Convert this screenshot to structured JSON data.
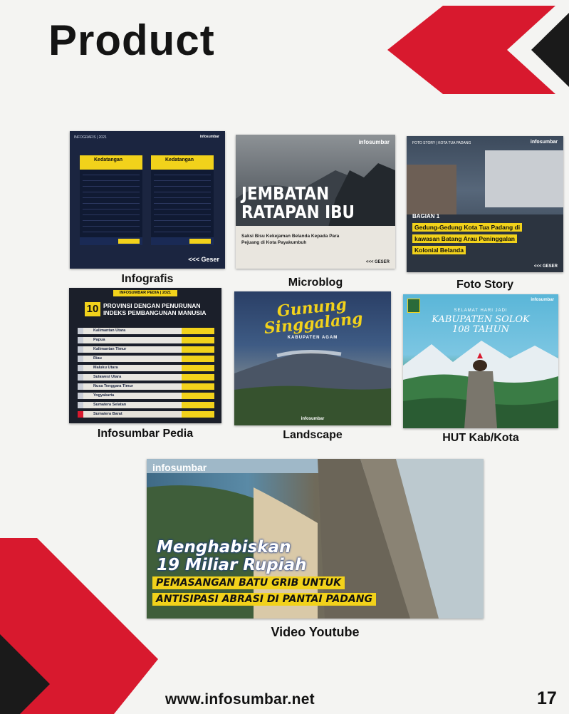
{
  "page": {
    "title": "Product",
    "website": "www.infosumbar.net",
    "page_number": "17"
  },
  "colors": {
    "accent_red": "#d8192e",
    "brand_yellow": "#f2d21b",
    "dark": "#141414"
  },
  "products": [
    {
      "caption": "Infografis",
      "thumb": {
        "tag": "INFOGRAFIS | 2021",
        "brand": "infosumbar",
        "panel_left": "Kedatangan",
        "panel_right": "Kedatangan",
        "geser": "<<< Geser"
      }
    },
    {
      "caption": "Microblog",
      "thumb": {
        "brand": "infosumbar",
        "headline_1": "JEMBATAN",
        "headline_2": "RATAPAN IBU",
        "sub": "Saksi Bisu Kekejaman Belanda Kepada Para Pejuang di Kota Payakumbuh",
        "geser": "<<< GESER"
      }
    },
    {
      "caption": "Foto Story",
      "thumb": {
        "tag": "FOTO STORY | KOTA TUA PADANG",
        "brand": "infosumbar",
        "part": "BAGIAN 1",
        "line_1": "Gedung-Gedung Kota Tua Padang di",
        "line_2": "kawasan Batang Arau Peninggalan",
        "line_3": "Kolonial Belanda",
        "geser": "<<< GESER"
      }
    },
    {
      "caption": "Infosumbar Pedia",
      "thumb": {
        "tag": "INFOSUMBAR PEDIA | 2021",
        "number": "10",
        "title_1": "PROVINSI DENGAN PENURUNAN",
        "title_2": "INDEKS PEMBANGUNAN MANUSIA",
        "rows": [
          "Kalimantan Utara",
          "Papua",
          "Kalimantan Timur",
          "Riau",
          "Maluku Utara",
          "Sulawesi Utara",
          "Nusa Tenggara Timur",
          "Yogyakarta",
          "Sumatera Selatan",
          "Sumatera Barat"
        ]
      }
    },
    {
      "caption": "Landscape",
      "thumb": {
        "script_1": "Gunung",
        "script_2": "Singgalang",
        "sub": "KABUPATEN AGAM",
        "brand": "infosumbar"
      }
    },
    {
      "caption": "HUT Kab/Kota",
      "thumb": {
        "greet": "SELAMAT HARI JADI",
        "line_1": "KABUPATEN SOLOK",
        "line_2": "108 TAHUN",
        "brand": "infosumbar"
      }
    }
  ],
  "video": {
    "caption": "Video Youtube",
    "brand": "infosumbar",
    "headline_1": "Menghabiskan",
    "headline_2": "19 Miliar Rupiah",
    "sub_1": "PEMASANGAN BATU GRIB UNTUK",
    "sub_2": "ANTISIPASI ABRASI DI PANTAI PADANG"
  }
}
